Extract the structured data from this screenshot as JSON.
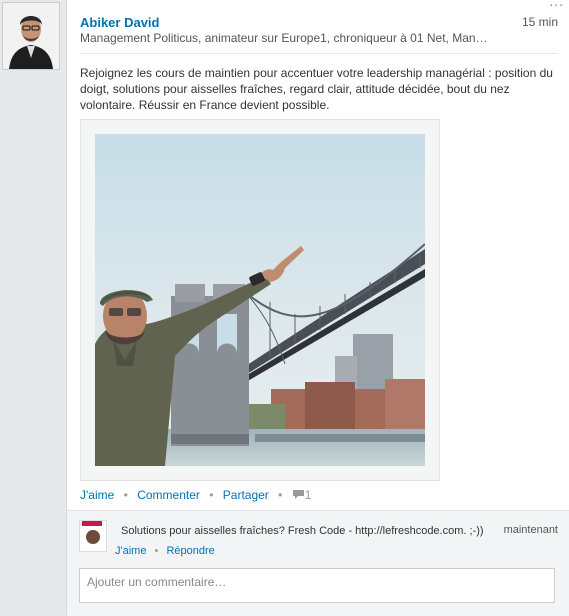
{
  "post": {
    "author_name": "Abiker David",
    "time": "15 min",
    "headline": "Management Politicus, animateur sur Europe1, chroniqueur à 01 Net, Man…",
    "more_glyph": "...",
    "text": "Rejoignez les cours de maintien pour accentuer votre leadership managérial : position du doigt, solutions pour aisselles fraîches, regard clair, attitude décidée, bout du nez volontaire. Réussir en France devient possible.",
    "actions": {
      "like": "J'aime",
      "comment": "Commenter",
      "share": "Partager",
      "separator": "•",
      "comment_count": "1",
      "comment_icon": "speech-bubble-icon"
    }
  },
  "comment": {
    "text": "Solutions pour aisselles fraîches? Fresh Code - http://lefreshcode.com. ;-))",
    "time": "maintenant",
    "like": "J'aime",
    "reply": "Répondre",
    "separator": "•"
  },
  "comment_input": {
    "placeholder": "Ajouter un commentaire…"
  },
  "colors": {
    "link": "#0073b1",
    "background": "#e6e9ec",
    "card": "#ffffff"
  }
}
